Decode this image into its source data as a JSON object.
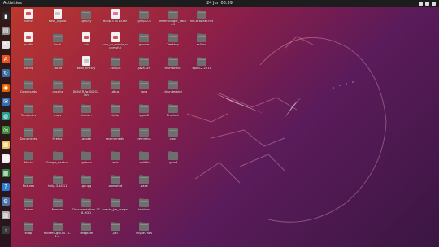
{
  "topbar": {
    "activities": "Activities",
    "clock": "24 Jun 08:39"
  },
  "dock": [
    {
      "name": "terminal",
      "color": "#2b2b2b",
      "glyph": "▮"
    },
    {
      "name": "files",
      "color": "#8f8f8f",
      "glyph": "▤"
    },
    {
      "name": "text-editor",
      "color": "#e0e0e0",
      "glyph": "✎"
    },
    {
      "name": "store",
      "color": "#e95420",
      "glyph": "A"
    },
    {
      "name": "sync",
      "color": "#3a6ea5",
      "glyph": "↻"
    },
    {
      "name": "firefox",
      "color": "#e66000",
      "glyph": "◉"
    },
    {
      "name": "thunderbird",
      "color": "#2f6fb3",
      "glyph": "✉"
    },
    {
      "name": "maps",
      "color": "#2a9d8f",
      "glyph": "◍"
    },
    {
      "name": "chrome",
      "color": "#3d8b3d",
      "glyph": "◎"
    },
    {
      "name": "notes",
      "color": "#e8c15a",
      "glyph": "▦"
    },
    {
      "name": "writer",
      "color": "#f0f0f0",
      "glyph": "▤"
    },
    {
      "name": "calc",
      "color": "#2e8540",
      "glyph": "▦"
    },
    {
      "name": "help",
      "color": "#2f7bd1",
      "glyph": "?"
    },
    {
      "name": "python",
      "color": "#4a74a8",
      "glyph": "⚙"
    },
    {
      "name": "trash",
      "color": "#b0b0b0",
      "glyph": "▥"
    },
    {
      "name": "show-apps",
      "color": "#3a3a3a",
      "glyph": "⁝"
    }
  ],
  "icons": [
    {
      "label": "Admin",
      "kind": "file",
      "mark": "#d9534f"
    },
    {
      "label": "bash_logout",
      "kind": "file",
      "mark": "#c8c8c8"
    },
    {
      "label": ".ghipsy",
      "kind": "folder"
    },
    {
      "label": "ftplip-3.5013.tar",
      "kind": "file",
      "mark": "#e86ea8"
    },
    {
      "label": ".gimp-2.8",
      "kind": "folder"
    },
    {
      "label": "Terminologer_a6c0-e5",
      "kind": "folder"
    },
    {
      "label": "net-browser.net",
      "kind": "folder"
    },
    {
      "label": ".profile",
      "kind": "file",
      "mark": "#d9534f"
    },
    {
      "label": ".local",
      "kind": "folder"
    },
    {
      "label": ".ssh",
      "kind": "file",
      "mark": "#d9534f"
    },
    {
      "label": "sudo_as_admin_successful",
      "kind": "file",
      "mark": "#d9534f"
    },
    {
      "label": "gnome",
      "kind": "folder"
    },
    {
      "label": "Desktop",
      "kind": "folder"
    },
    {
      "label": "eclipse",
      "kind": "folder"
    },
    {
      "label": ".config",
      "kind": "folder"
    },
    {
      "label": ".cache",
      "kind": "folder"
    },
    {
      "label": "bash_history",
      "kind": "file",
      "mark": "#c8c8c8"
    },
    {
      "label": ".compiz",
      "kind": "folder"
    },
    {
      "label": ".java.sch",
      "kind": "folder"
    },
    {
      "label": "thumbnails",
      "kind": "folder"
    },
    {
      "label": "ftplip-2.2013",
      "kind": "folder"
    },
    {
      "label": "Downloads",
      "kind": "folder"
    },
    {
      "label": ".mozilla",
      "kind": "folder"
    },
    {
      "label": "DRIVER-fw-00207.bin",
      "kind": "folder"
    },
    {
      "label": ".dbus",
      "kind": "folder"
    },
    {
      "label": ".java",
      "kind": "folder"
    },
    {
      "label": ".thunderbird",
      "kind": "folder"
    },
    {
      "label": "Templates",
      "kind": "folder"
    },
    {
      "label": ".cups",
      "kind": "folder"
    },
    {
      "label": ".bitcoin",
      "kind": "folder"
    },
    {
      "label": ".fplip",
      "kind": "folder"
    },
    {
      "label": ".pgtw2",
      "kind": "folder"
    },
    {
      "label": "Trashed",
      "kind": "folder"
    },
    {
      "label": "Documents",
      "kind": "folder"
    },
    {
      "label": "Firefox",
      "kind": "folder"
    },
    {
      "label": ".adobe",
      "kind": "folder"
    },
    {
      "label": ".macromedia",
      "kind": "folder"
    },
    {
      "label": ".remmina",
      "kind": "folder"
    },
    {
      "label": ".vbox",
      "kind": "folder"
    },
    {
      "label": "Music",
      "kind": "folder"
    },
    {
      "label": "Google_backup",
      "kind": "folder"
    },
    {
      "label": ".gphoto",
      "kind": "folder"
    },
    {
      "label": ".epic",
      "kind": "folder"
    },
    {
      "label": ".sqlitdb",
      "kind": "folder"
    },
    {
      "label": ".gconf",
      "kind": "folder"
    },
    {
      "label": "Pictures",
      "kind": "folder"
    },
    {
      "label": "hplip-3.16.11",
      "kind": "folder"
    },
    {
      "label": ".gnupg",
      "kind": "folder"
    },
    {
      "label": ".openshot",
      "kind": "folder"
    },
    {
      "label": ".saxe",
      "kind": "folder"
    },
    {
      "label": "Videos",
      "kind": "folder"
    },
    {
      "label": "Monero",
      "kind": "folder"
    },
    {
      "label": "Documentation-178-HDD",
      "kind": "folder"
    },
    {
      "label": "oracle_jre_usage",
      "kind": "folder"
    },
    {
      "label": "lockbox",
      "kind": "folder"
    },
    {
      "label": "snap",
      "kind": "folder"
    },
    {
      "label": "monero-gui-v0.11.1.0",
      "kind": "folder"
    },
    {
      "label": "Telegram",
      "kind": "folder"
    },
    {
      "label": ".pki",
      "kind": "folder"
    },
    {
      "label": "Skype-Files",
      "kind": "folder"
    }
  ]
}
